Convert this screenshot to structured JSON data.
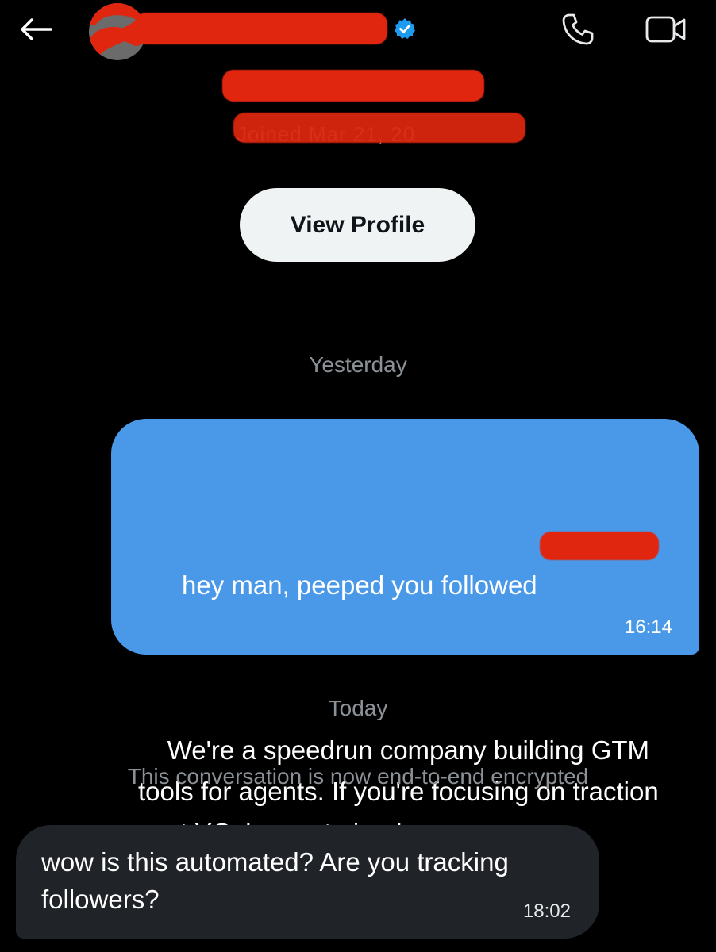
{
  "header": {
    "back_icon": "arrow-left-icon",
    "verified_icon": "verified-badge-icon",
    "call_icon": "phone-icon",
    "video_icon": "video-camera-icon",
    "joined_text": "Joined Mar 21, 20"
  },
  "profile": {
    "view_profile_label": "View Profile"
  },
  "conversation": {
    "separators": {
      "yesterday": "Yesterday",
      "today": "Today"
    },
    "encryption_notice": "This conversation is now end-to-end encrypted",
    "messages": [
      {
        "direction": "outgoing",
        "line1": "hey man, peeped you followed",
        "body": "We're a speedrun company building GTM tools for agents. If you're focusing on traction post YC, happy to jam!",
        "time": "16:14"
      },
      {
        "direction": "incoming",
        "body": "wow is this automated? Are you tracking followers?",
        "time": "18:02"
      }
    ]
  },
  "colors": {
    "background": "#000000",
    "outgoing_bubble": "#4a99e9",
    "incoming_bubble": "#202327",
    "view_profile_bg": "#eff3f4",
    "muted_text": "#8b9196",
    "redaction": "#e0260f",
    "verified": "#1d9bf0"
  }
}
